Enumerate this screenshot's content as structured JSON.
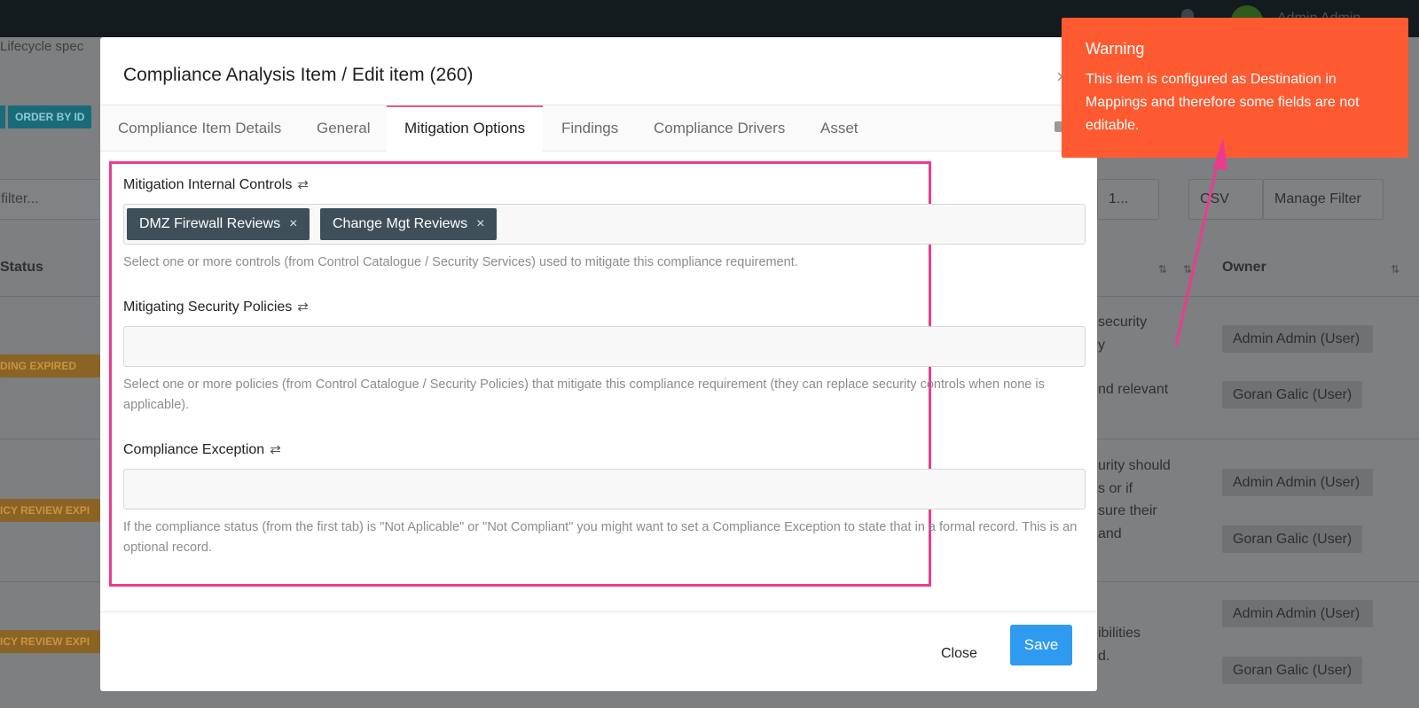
{
  "background": {
    "topbar": {
      "user_label": "Admin Admin"
    },
    "breadcrumb": "Lifecycle spec",
    "order_button": "ORDER BY ID",
    "filter_placeholder": "filter...",
    "status_header": "Status",
    "owner_header": "Owner",
    "page_select": "1...",
    "csv_label": "CSV",
    "manage_filter_label": "Manage Filter",
    "badges": [
      "DING EXPIRED",
      "ICY REVIEW EXPI",
      "ICY REVIEW EXPI"
    ],
    "rows": [
      {
        "text_lines": [
          "security",
          "y",
          "",
          "nd relevant"
        ],
        "owners": [
          "Admin Admin (User)",
          "Goran Galic (User)"
        ]
      },
      {
        "text_lines": [
          "urity should",
          "s or if",
          "sure their",
          "and"
        ],
        "owners": [
          "Admin Admin (User)",
          "Goran Galic (User)"
        ]
      },
      {
        "text_lines": [
          "ibilities",
          "d."
        ],
        "owners": [
          "Admin Admin (User)",
          "Goran Galic (User)"
        ]
      }
    ]
  },
  "modal": {
    "title": "Compliance Analysis Item / Edit item (260)",
    "close_icon": "×",
    "tabs": [
      {
        "label": "Compliance Item Details",
        "active": false
      },
      {
        "label": "General",
        "active": false
      },
      {
        "label": "Mitigation Options",
        "active": true
      },
      {
        "label": "Findings",
        "active": false
      },
      {
        "label": "Compliance Drivers",
        "active": false
      },
      {
        "label": "Asset",
        "active": false
      }
    ],
    "fields": {
      "controls": {
        "label": "Mitigation Internal Controls",
        "tags": [
          "DMZ Firewall Reviews",
          "Change Mgt Reviews"
        ],
        "help": "Select one or more controls (from Control Catalogue / Security Services) used to mitigate this compliance requirement."
      },
      "policies": {
        "label": "Mitigating Security Policies",
        "help": "Select one or more policies (from Control Catalogue / Security Policies) that mitigate this compliance requirement (they can replace security controls when none is applicable)."
      },
      "exception": {
        "label": "Compliance Exception",
        "help": "If the compliance status (from the first tab) is \"Not Aplicable\" or \"Not Compliant\" you might want to set a Compliance Exception to state that in a formal record. This is an optional record."
      }
    },
    "footer": {
      "close_label": "Close",
      "save_label": "Save"
    }
  },
  "warning": {
    "title": "Warning",
    "text": "This item is configured as Destination in Mappings and therefore some fields are not editable."
  },
  "icons": {
    "sync": "sync-icon",
    "tag_remove": "×"
  },
  "colors": {
    "accent": "#2e9af0",
    "warning": "#fe5a31",
    "highlight": "#ec3b8f",
    "tag": "#3f4f59"
  }
}
